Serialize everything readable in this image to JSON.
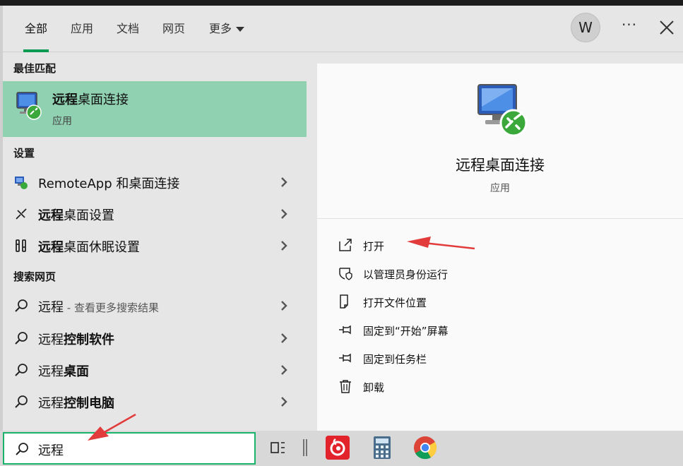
{
  "tabs": [
    {
      "label": "全部"
    },
    {
      "label": "应用"
    },
    {
      "label": "文档"
    },
    {
      "label": "网页"
    },
    {
      "label": "更多"
    }
  ],
  "user": {
    "avatar_letter": "W"
  },
  "controls": {
    "more_options": "···"
  },
  "sections": {
    "best_match": "最佳匹配",
    "settings": "设置",
    "web": "搜索网页"
  },
  "best_match": {
    "title_bold": "远程",
    "title_rest": "桌面连接",
    "subtitle": "应用"
  },
  "settings_items": [
    {
      "bold": "",
      "rest": "RemoteApp 和桌面连接"
    },
    {
      "bold": "远程",
      "rest": "桌面设置"
    },
    {
      "bold": "远程",
      "rest": "桌面休眠设置"
    }
  ],
  "web_items": [
    {
      "plain": "远程",
      "bold": "",
      "sub": " - 查看更多搜索结果"
    },
    {
      "plain": "远程",
      "bold": "控制软件",
      "sub": ""
    },
    {
      "plain": "远程",
      "bold": "桌面",
      "sub": ""
    },
    {
      "plain": "远程",
      "bold": "控制电脑",
      "sub": ""
    }
  ],
  "detail": {
    "title": "远程桌面连接",
    "subtitle": "应用",
    "actions": [
      {
        "label": "打开",
        "icon": "open-icon"
      },
      {
        "label": "以管理员身份运行",
        "icon": "shield-icon"
      },
      {
        "label": "打开文件位置",
        "icon": "file-location-icon"
      },
      {
        "label": "固定到“开始”屏幕",
        "icon": "pin-icon"
      },
      {
        "label": "固定到任务栏",
        "icon": "pin-icon"
      },
      {
        "label": "卸载",
        "icon": "trash-icon"
      }
    ]
  },
  "search": {
    "value": "远程"
  },
  "taskbar_icons": [
    "task-view-icon",
    "netease-music-icon",
    "calculator-icon",
    "chrome-icon"
  ],
  "colors": {
    "accent": "#0b9a52",
    "best_match_bg": "#8fd1b0",
    "search_border": "#19b36b",
    "annotation_arrow": "#e23b3b"
  }
}
